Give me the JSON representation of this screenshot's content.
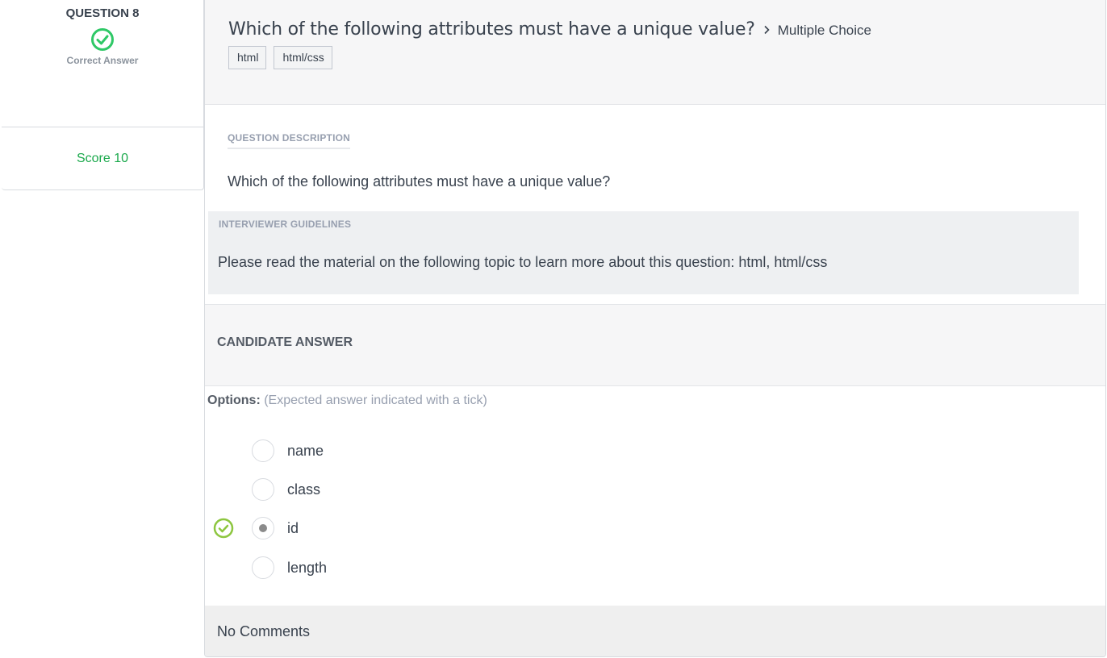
{
  "question": {
    "number_label": "QUESTION 8",
    "status_text": "Correct Answer",
    "score_label": "Score 10",
    "title": "Which of the following attributes must have a unique value?",
    "type": "Multiple Choice",
    "tags": [
      "html",
      "html/css"
    ]
  },
  "description": {
    "label": "QUESTION DESCRIPTION",
    "text": "Which of the following attributes must have a unique value?"
  },
  "guidelines": {
    "label": "INTERVIEWER GUIDELINES",
    "text": "Please read the material on the following topic to learn more about this question: html, html/css"
  },
  "answer": {
    "label": "CANDIDATE ANSWER",
    "options_label": "Options:",
    "options_hint": "(Expected answer indicated with a tick)",
    "options": [
      {
        "label": "name",
        "selected": false,
        "expected": false
      },
      {
        "label": "class",
        "selected": false,
        "expected": false
      },
      {
        "label": "id",
        "selected": true,
        "expected": true
      },
      {
        "label": "length",
        "selected": false,
        "expected": false
      }
    ]
  },
  "comments": {
    "text": "No Comments"
  },
  "colors": {
    "correct": "#2ec866",
    "tick": "#8dc63f",
    "score": "#1ba94c"
  },
  "icons": {
    "status": "check-circle-icon",
    "header_separator": "chevron-right-icon",
    "expected": "check-circle-icon"
  }
}
